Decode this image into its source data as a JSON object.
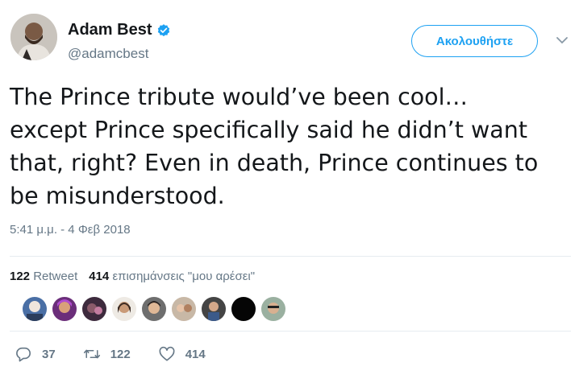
{
  "author": {
    "display_name": "Adam Best",
    "handle": "@adamcbest",
    "avatar_icon": "profile-photo",
    "verified_icon": "verified-badge-icon"
  },
  "follow_button": {
    "label": "Ακολουθήστε"
  },
  "menu_icon": "chevron-down-icon",
  "tweet": {
    "lines": [
      "The Prince tribute would’ve been cool…",
      "except Prince specifically said he didn’t want",
      "that, right? Even in death, Prince continues to",
      "be misunderstood."
    ],
    "timestamp": "5:41 μ.μ. - 4 Φεβ 2018"
  },
  "stats": {
    "retweets_count": "122",
    "retweets_label": "Retweet",
    "likes_count": "414",
    "likes_label": "επισημάνσεις \"μου αρέσει\""
  },
  "likers_count_shown": 9,
  "actions": {
    "reply_count": "37",
    "retweet_count": "122",
    "like_count": "414"
  },
  "colors": {
    "accent": "#1da1f2",
    "secondary_text": "#657786",
    "divider": "#e6ecf0"
  }
}
